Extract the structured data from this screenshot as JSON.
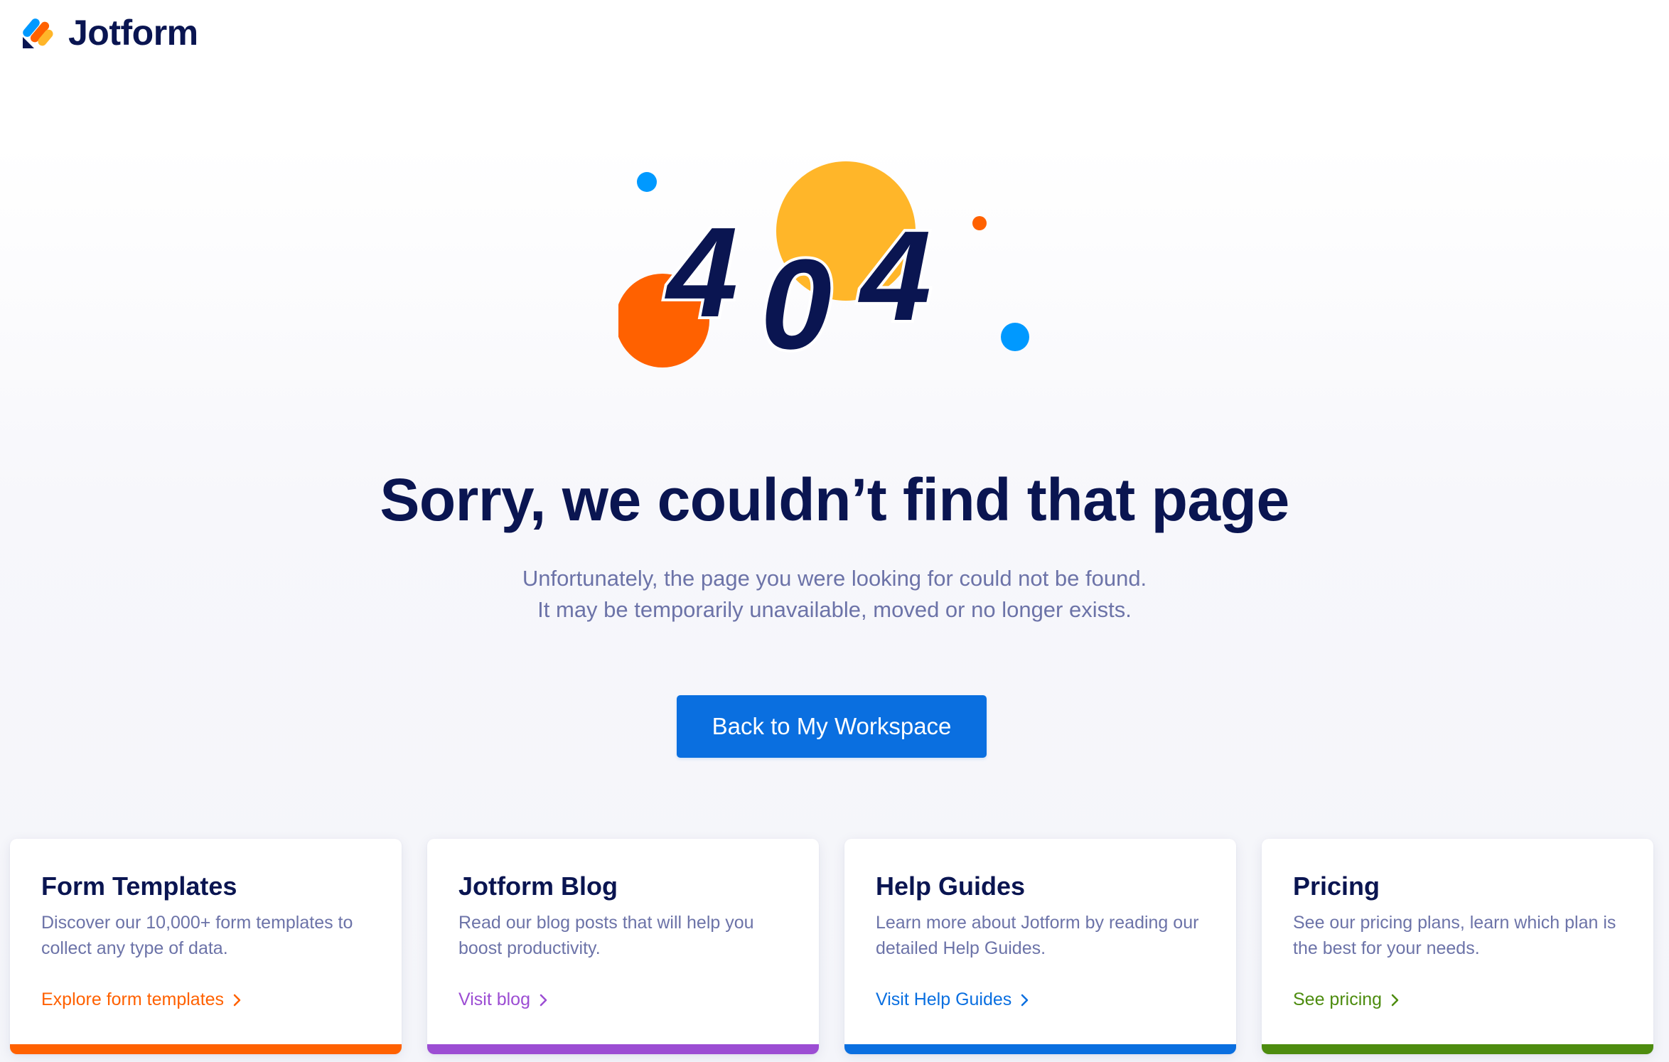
{
  "brand": {
    "name": "Jotform",
    "colors": {
      "navy": "#0a1551",
      "orange": "#ff6100",
      "yellow": "#ffb629",
      "blue": "#0099ff"
    }
  },
  "illustration": {
    "text": "404",
    "icon": "404-illustration"
  },
  "main": {
    "title": "Sorry, we couldn’t find that page",
    "subtitle_line1": "Unfortunately, the page you were looking for could not be found.",
    "subtitle_line2": "It may be temporarily unavailable, moved or no longer exists.",
    "cta_label": "Back to My Workspace"
  },
  "cards": [
    {
      "title": "Form Templates",
      "description": "Discover our 10,000+ form templates to collect any type of data.",
      "link": "Explore form templates",
      "color": "#ff6100"
    },
    {
      "title": "Jotform Blog",
      "description": "Read our blog posts that will help you boost productivity.",
      "link": "Visit blog",
      "color": "#9c4dd3"
    },
    {
      "title": "Help Guides",
      "description": "Learn more about Jotform by reading our detailed Help Guides.",
      "link": "Visit Help Guides",
      "color": "#0a6fe0"
    },
    {
      "title": "Pricing",
      "description": "See our pricing plans, learn which plan is the best for your needs.",
      "link": "See pricing",
      "color": "#4d8c0f"
    }
  ]
}
